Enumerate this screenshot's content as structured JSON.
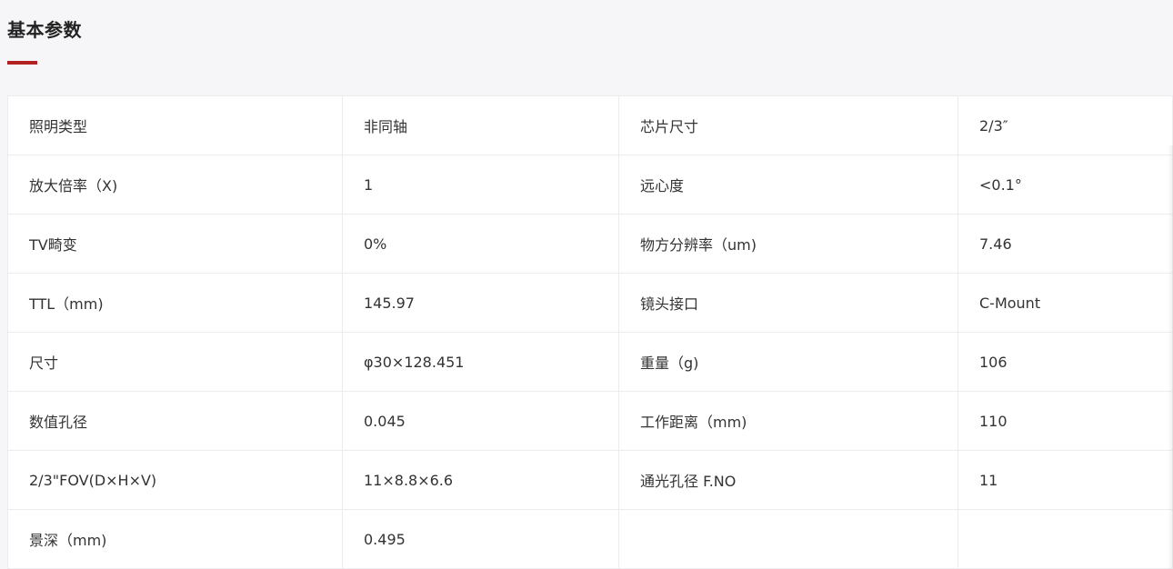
{
  "section": {
    "title": "基本参数",
    "accent_color": "#b22222"
  },
  "spec_table": {
    "rows": [
      {
        "label1": "照明类型",
        "value1": "非同轴",
        "label2": "芯片尺寸",
        "value2": "2/3″"
      },
      {
        "label1": "放大倍率（X)",
        "value1": "1",
        "label2": "远心度",
        "value2": "<0.1°"
      },
      {
        "label1": "TV畸变",
        "value1": "0%",
        "label2": "物方分辨率（um)",
        "value2": "7.46"
      },
      {
        "label1": "TTL（mm)",
        "value1": "145.97",
        "label2": "镜头接口",
        "value2": "C-Mount"
      },
      {
        "label1": "尺寸",
        "value1": "φ30×128.451",
        "label2": "重量（g)",
        "value2": "106"
      },
      {
        "label1": "数值孔径",
        "value1": "0.045",
        "label2": "工作距离（mm)",
        "value2": "110"
      },
      {
        "label1": "2/3\"FOV(D×H×V)",
        "value1": "11×8.8×6.6",
        "label2": "通光孔径 F.NO",
        "value2": "11"
      },
      {
        "label1": "景深（mm)",
        "value1": "0.495",
        "label2": "",
        "value2": ""
      }
    ]
  }
}
